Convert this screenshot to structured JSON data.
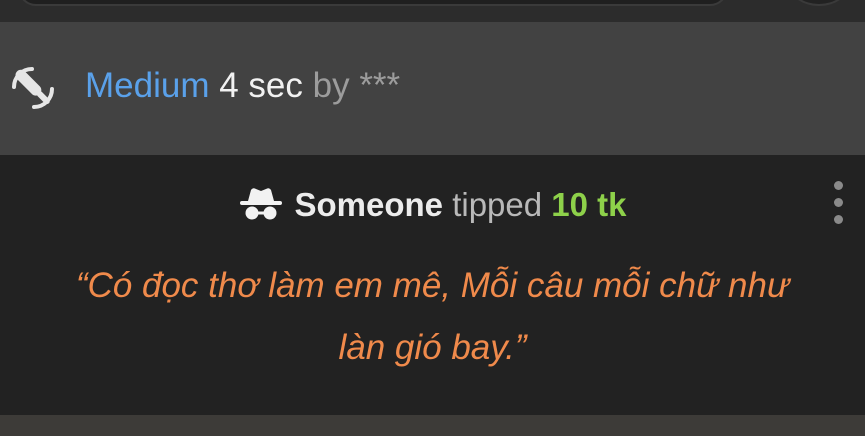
{
  "vibration_event": {
    "level": "Medium",
    "duration": "4 sec",
    "by_label": "by",
    "tipper": "***",
    "icon": "vibration-wand-icon"
  },
  "tip_event": {
    "icon": "incognito-icon",
    "tipper_name": "Someone",
    "verb": "tipped",
    "amount": "10 tk",
    "message": "“Có đọc thơ làm em mê, Mỗi câu mỗi chữ như làn gió bay.”",
    "menu_icon": "more-vertical-icon"
  },
  "colors": {
    "level_blue": "#5aa1ea",
    "amount_green": "#8ed14a",
    "message_orange": "#f08a4b"
  }
}
